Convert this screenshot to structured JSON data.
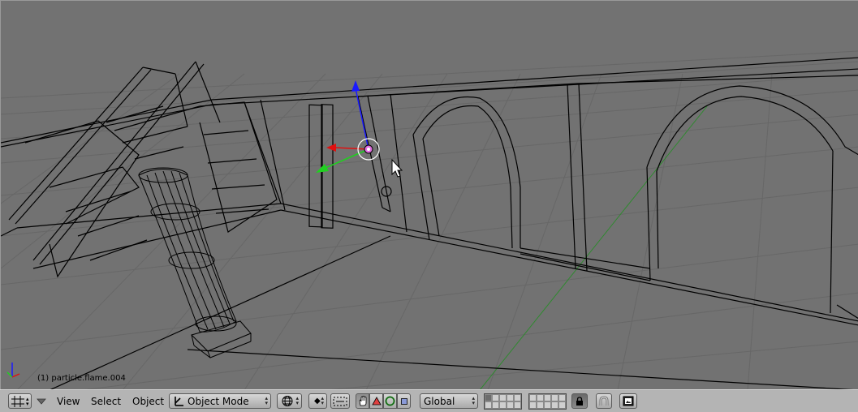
{
  "viewport": {
    "object_info": "(1) particle.flame.004"
  },
  "header": {
    "menus": {
      "view": "View",
      "select": "Select",
      "object": "Object"
    },
    "mode_dropdown": {
      "label": "Object Mode",
      "icon": "object-mode-icon"
    },
    "draw_type_icon": "draw-type-sphere-icon",
    "pivot_icon": "pivot-point-icon",
    "manipulator_icons": [
      "hand-icon",
      "translate-triangle-icon",
      "rotate-ring-icon",
      "scale-square-icon"
    ],
    "orientation_dropdown": {
      "label": "Global"
    },
    "layers": {
      "first_block_active": [
        1
      ],
      "second_block_active": []
    },
    "lock_icon": "lock-icon",
    "snap_icon": "magnet-icon",
    "render_icon": "render-preview-icon"
  },
  "colors": {
    "viewport_bg": "#727272",
    "grid": "#646464",
    "wire": "#000000",
    "axis_x": "#e01010",
    "axis_y": "#20d020",
    "axis_z": "#1a1aff",
    "header_bg": "#b4b4b4"
  }
}
